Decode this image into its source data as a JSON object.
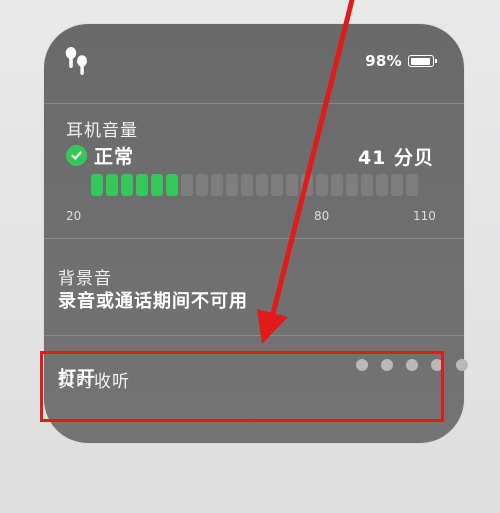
{
  "header": {
    "device_icon": "airpods-icon",
    "battery_percent_text": "98%",
    "battery_level": 0.98
  },
  "headphone_level": {
    "title": "耳机音量",
    "status": "正常",
    "status_icon": "checkmark-circle-icon",
    "status_color": "#35c759",
    "value_text": "41 分贝",
    "meter": {
      "min": 20,
      "max": 110,
      "current_db": 41,
      "total_bars": 22,
      "active_bars": 6,
      "active_color": "#35c759",
      "inactive_color": "#848484",
      "tick_labels": [
        "20",
        "80",
        "110"
      ]
    }
  },
  "background_sounds": {
    "title": "背景音",
    "value": "录音或通话期间不可用"
  },
  "live_listen": {
    "title": "实时收听",
    "value": "打开",
    "dot_count": 5
  },
  "annotation": {
    "color": "#e11a1a"
  }
}
